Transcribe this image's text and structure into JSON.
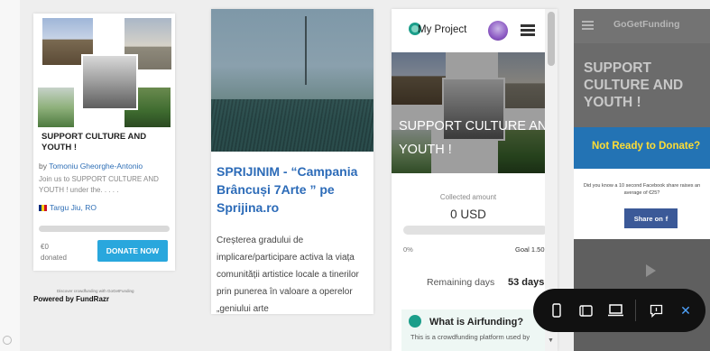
{
  "card1": {
    "title": "SUPPORT CULTURE AND YOUTH !",
    "by_prefix": "by",
    "author": "Tomoniu Gheorghe-Antonio",
    "description": "Join us to SUPPORT CULTURE AND YOUTH ! under the. . . . .",
    "location": "Targu Jiu, RO",
    "amount": "€0",
    "amount_label": "donated",
    "donate_label": "DONATE NOW",
    "discover": "Discover crowdfunding with GoGetFunding",
    "powered": "Powered by FundRazr",
    "progress": 0
  },
  "card2": {
    "headline": "SPRIJINIM - “Campania Brâncuși 7Arte ” pe Sprijina.ro",
    "body": "Creșterea gradului de implicare/participare activa la viața comunității artistice locale a tinerilor prin punerea în valoare a operelor „geniului arte"
  },
  "phone": {
    "project_label": "My Project",
    "hero_title": "SUPPORT CULTURE AND YOUTH !",
    "collected_label": "Collected amount",
    "collected_value": "0 USD",
    "percent": "0%",
    "goal": "Goal 1.50",
    "progress": 0,
    "remaining_label": "Remaining days",
    "remaining_value": "53 days",
    "info_title": "What is Airfunding?",
    "info_sub": "This is a crowdfunding platform used by"
  },
  "ggf": {
    "brand": "GoGetFunding",
    "headline": "SUPPORT CULTURE AND YOUTH !",
    "banner": "Not Ready to Donate?",
    "box_text": "Did you know a 10 second Facebook share raises an average of €25?",
    "share_label": "Share on",
    "share_icon": "f"
  },
  "toolbar": {
    "items": [
      "mobile-view",
      "tablet-view",
      "desktop-view",
      "feedback",
      "close"
    ],
    "close_glyph": "✕"
  },
  "colors": {
    "link": "#2f6fb6",
    "donate": "#29a7dd",
    "headline_blue": "#2c6bb8",
    "ggf_banner": "#2373b4",
    "ggf_yellow": "#ffdd33",
    "facebook": "#3b5998",
    "airfunding_green": "#1b9e8a"
  }
}
